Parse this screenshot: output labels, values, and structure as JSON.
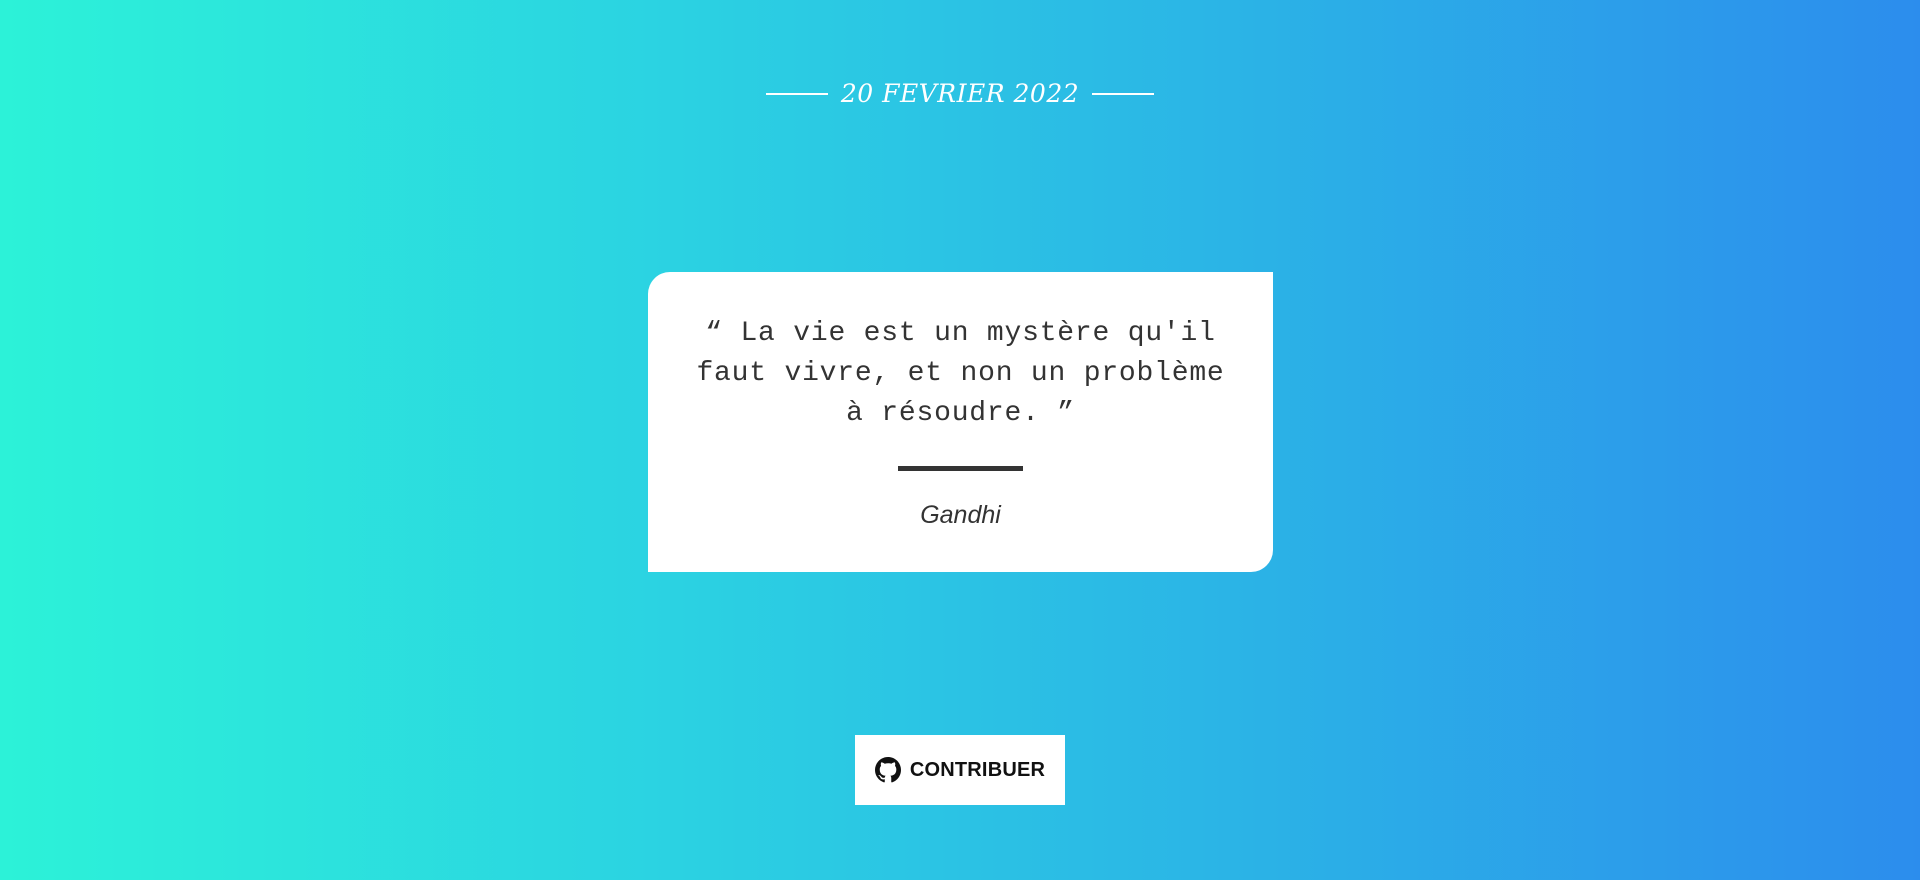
{
  "header": {
    "date": "20 FEVRIER 2022"
  },
  "quote": {
    "text": "“ La vie est un mystère qu'il faut vivre, et non un problème à résoudre. ”",
    "author": "Gandhi"
  },
  "footer": {
    "contribute_label": "CONTRIBUER",
    "contribute_icon": "github-icon"
  },
  "colors": {
    "gradient_start": "#2cf2d8",
    "gradient_end": "#2c8ded",
    "card_background": "#ffffff",
    "text": "#333333"
  }
}
